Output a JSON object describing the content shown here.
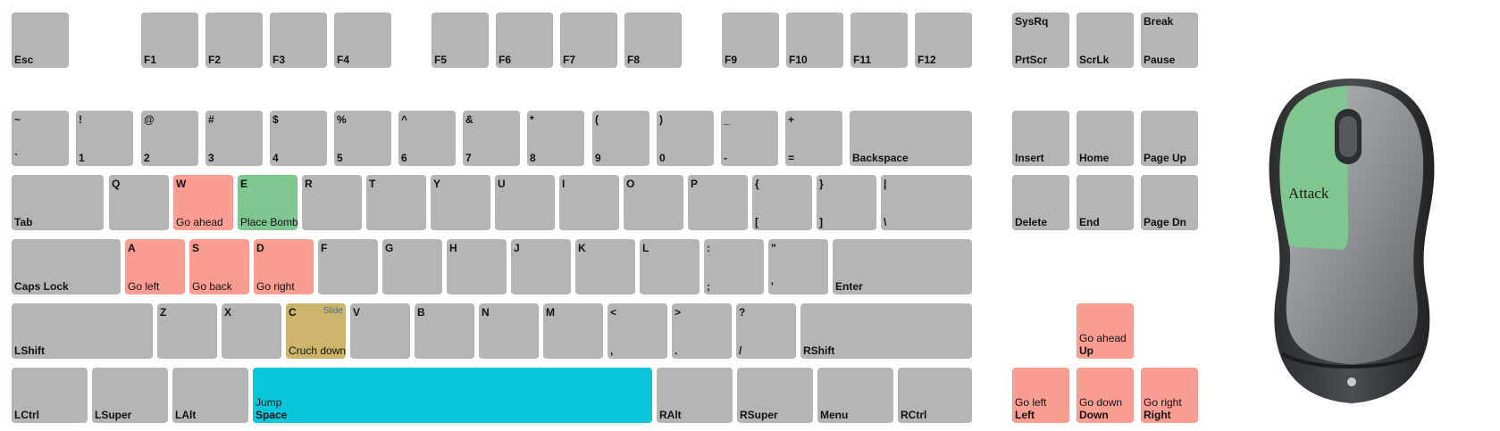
{
  "keyboard": {
    "keys": [
      {
        "id": "esc",
        "bl": "Esc"
      },
      {
        "id": "f1",
        "bl": "F1"
      },
      {
        "id": "f2",
        "bl": "F2"
      },
      {
        "id": "f3",
        "bl": "F3"
      },
      {
        "id": "f4",
        "bl": "F4"
      },
      {
        "id": "f5",
        "bl": "F5"
      },
      {
        "id": "f6",
        "bl": "F6"
      },
      {
        "id": "f7",
        "bl": "F7"
      },
      {
        "id": "f8",
        "bl": "F8"
      },
      {
        "id": "f9",
        "bl": "F9"
      },
      {
        "id": "f10",
        "bl": "F10"
      },
      {
        "id": "f11",
        "bl": "F11"
      },
      {
        "id": "f12",
        "bl": "F12"
      },
      {
        "id": "prtscr",
        "tl": "SysRq",
        "bl": "PrtScr"
      },
      {
        "id": "scrlk",
        "bl": "ScrLk"
      },
      {
        "id": "pause",
        "tl": "Break",
        "bl": "Pause"
      },
      {
        "id": "grave",
        "tl": "~",
        "bl": "`"
      },
      {
        "id": "n1",
        "tl": "!",
        "bl": "1"
      },
      {
        "id": "n2",
        "tl": "@",
        "bl": "2"
      },
      {
        "id": "n3",
        "tl": "#",
        "bl": "3"
      },
      {
        "id": "n4",
        "tl": "$",
        "bl": "4"
      },
      {
        "id": "n5",
        "tl": "%",
        "bl": "5"
      },
      {
        "id": "n6",
        "tl": "^",
        "bl": "6"
      },
      {
        "id": "n7",
        "tl": "&",
        "bl": "7"
      },
      {
        "id": "n8",
        "tl": "*",
        "bl": "8"
      },
      {
        "id": "n9",
        "tl": "(",
        "bl": "9"
      },
      {
        "id": "n0",
        "tl": ")",
        "bl": "0"
      },
      {
        "id": "minus",
        "tl": "_",
        "bl": "-"
      },
      {
        "id": "equals",
        "tl": "+",
        "bl": "="
      },
      {
        "id": "backspace",
        "bl": "Backspace"
      },
      {
        "id": "insert",
        "bl": "Insert"
      },
      {
        "id": "home",
        "bl": "Home"
      },
      {
        "id": "pageup",
        "bl": "Page Up"
      },
      {
        "id": "tab",
        "bl": "Tab"
      },
      {
        "id": "q",
        "tl": "Q"
      },
      {
        "id": "w",
        "tl": "W",
        "fn": "Go ahead",
        "color": "red"
      },
      {
        "id": "e",
        "tl": "E",
        "fn": "Place Bomb",
        "color": "green"
      },
      {
        "id": "r",
        "tl": "R"
      },
      {
        "id": "t",
        "tl": "T"
      },
      {
        "id": "y",
        "tl": "Y"
      },
      {
        "id": "u",
        "tl": "U"
      },
      {
        "id": "i",
        "tl": "I"
      },
      {
        "id": "o",
        "tl": "O"
      },
      {
        "id": "p",
        "tl": "P"
      },
      {
        "id": "lbrace",
        "tl": "{",
        "bl": "["
      },
      {
        "id": "rbrace",
        "tl": "}",
        "bl": "]"
      },
      {
        "id": "backslash",
        "tl": "|",
        "bl": "\\"
      },
      {
        "id": "delete",
        "bl": "Delete"
      },
      {
        "id": "end",
        "bl": "End"
      },
      {
        "id": "pagedn",
        "bl": "Page Dn"
      },
      {
        "id": "capslock",
        "bl": "Caps Lock"
      },
      {
        "id": "a",
        "tl": "A",
        "fn": "Go left",
        "color": "red"
      },
      {
        "id": "s",
        "tl": "S",
        "fn": "Go back",
        "color": "red"
      },
      {
        "id": "d",
        "tl": "D",
        "fn": "Go right",
        "color": "red"
      },
      {
        "id": "f",
        "tl": "F"
      },
      {
        "id": "g",
        "tl": "G"
      },
      {
        "id": "h",
        "tl": "H"
      },
      {
        "id": "j",
        "tl": "J"
      },
      {
        "id": "k",
        "tl": "K"
      },
      {
        "id": "l",
        "tl": "L"
      },
      {
        "id": "semicolon",
        "tl": ":",
        "bl": ";"
      },
      {
        "id": "quote",
        "tl": "\"",
        "bl": "'"
      },
      {
        "id": "enter",
        "bl": "Enter"
      },
      {
        "id": "lshift",
        "bl": "LShift"
      },
      {
        "id": "z",
        "tl": "Z"
      },
      {
        "id": "x",
        "tl": "X"
      },
      {
        "id": "c",
        "tl": "C",
        "fn": "Cruch down",
        "note": "Slide",
        "color": "tan"
      },
      {
        "id": "v",
        "tl": "V"
      },
      {
        "id": "b",
        "tl": "B"
      },
      {
        "id": "n",
        "tl": "N"
      },
      {
        "id": "m",
        "tl": "M"
      },
      {
        "id": "comma",
        "tl": "<",
        "bl": ","
      },
      {
        "id": "period",
        "tl": ">",
        "bl": "."
      },
      {
        "id": "slash",
        "tl": "?",
        "bl": "/"
      },
      {
        "id": "rshift",
        "bl": "RShift"
      },
      {
        "id": "up",
        "fn": "Go ahead",
        "bl": "Up",
        "color": "red"
      },
      {
        "id": "lctrl",
        "bl": "LCtrl"
      },
      {
        "id": "lsuper",
        "bl": "LSuper"
      },
      {
        "id": "lalt",
        "bl": "LAlt"
      },
      {
        "id": "space",
        "fn": "Jump",
        "bl": "Space",
        "color": "cyan"
      },
      {
        "id": "ralt",
        "bl": "RAlt"
      },
      {
        "id": "rsuper",
        "bl": "RSuper"
      },
      {
        "id": "menu",
        "bl": "Menu"
      },
      {
        "id": "rctrl",
        "bl": "RCtrl"
      },
      {
        "id": "left",
        "fn": "Go left",
        "bl": "Left",
        "color": "red"
      },
      {
        "id": "down",
        "fn": "Go down",
        "bl": "Down",
        "color": "red"
      },
      {
        "id": "right",
        "fn": "Go right",
        "bl": "Right",
        "color": "red"
      }
    ]
  },
  "mouse": {
    "left_button_label": "Attack",
    "colors": {
      "highlight": "#80c690",
      "body_dark": "#2f3235",
      "body_mid": "#8b8e91"
    }
  }
}
